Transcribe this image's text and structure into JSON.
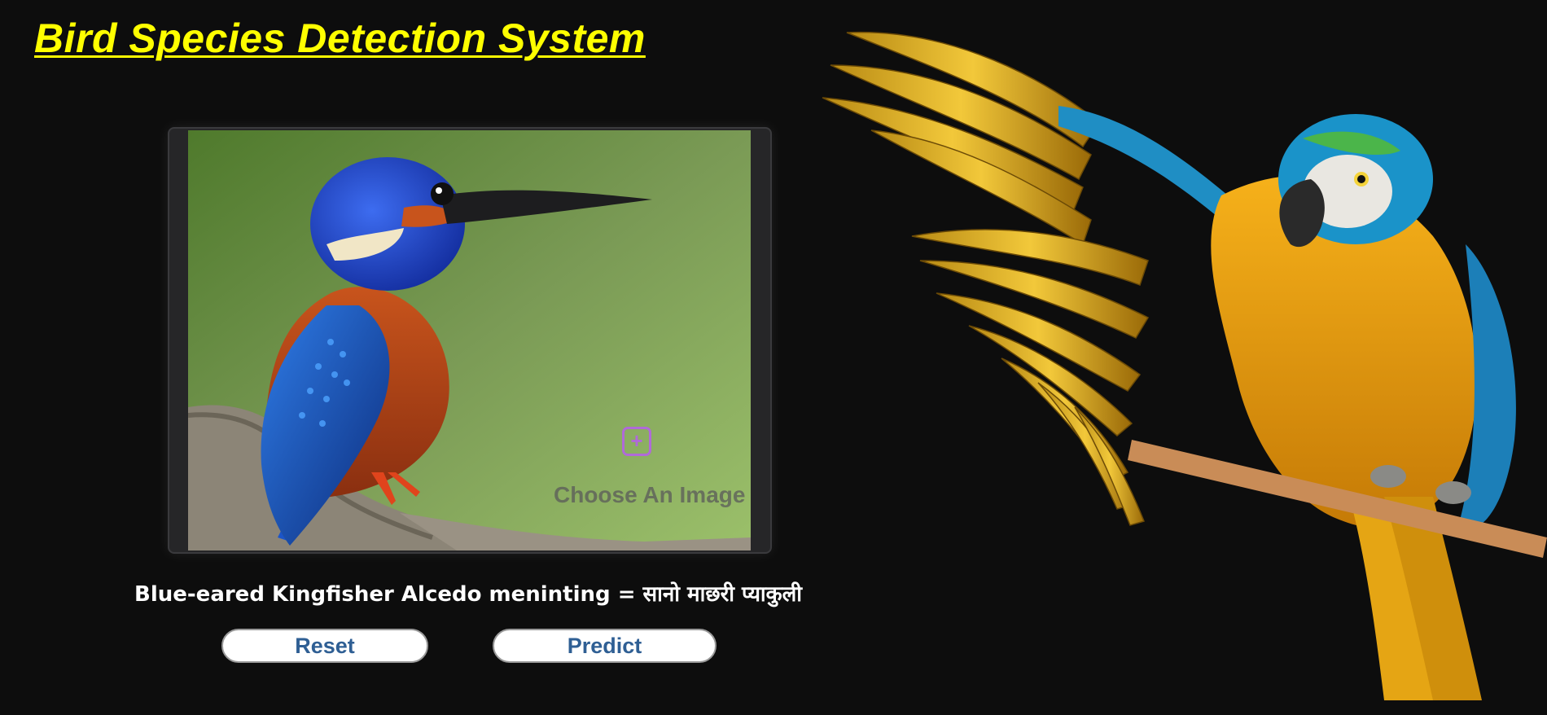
{
  "app": {
    "title": "Bird Species Detection System"
  },
  "upload": {
    "hint": "Choose An Image",
    "add_icon": "plus-square-icon"
  },
  "result": {
    "text": "Blue-eared Kingfisher Alcedo meninting = सानो माछरी प्याकुली"
  },
  "buttons": {
    "reset_label": "Reset",
    "predict_label": "Predict"
  },
  "colors": {
    "background": "#0d0d0d",
    "title": "#ffff00",
    "button_text": "#2f5f94",
    "upload_accent": "#b06ad8"
  }
}
